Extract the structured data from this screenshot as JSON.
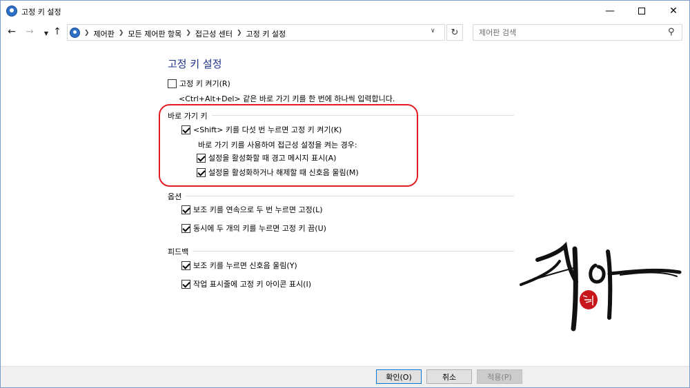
{
  "window": {
    "title": "고정 키 설정"
  },
  "nav": {
    "breadcrumbs": [
      "제어판",
      "모든 제어판 항목",
      "접근성 센터",
      "고정 키 설정"
    ],
    "search_placeholder": "제어판 검색"
  },
  "main": {
    "heading": "고정 키 설정",
    "turn_on": {
      "label": "고정 키 켜기(R)",
      "checked": false
    },
    "turn_on_desc": "<Ctrl+Alt+Del> 같은 바로 가기 키를 한 번에 하나씩 입력합니다.",
    "shortcut_section": {
      "title": "바로 가기 키",
      "shift_toggle": {
        "label": "<Shift> 키를 다섯 번 누르면 고정 키 켜기(K)",
        "checked": true
      },
      "sub_desc": "바로 가기 키를 사용하여 접근성 설정을 켜는 경우:",
      "warning": {
        "label": "설정을 활성화할 때 경고 메시지 표시(A)",
        "checked": true
      },
      "sound": {
        "label": "설정을 활성화하거나 해제할 때 신호음 울림(M)",
        "checked": true
      }
    },
    "options_section": {
      "title": "옵션",
      "lock": {
        "label": "보조 키를 연속으로 두 번 누르면 고정(L)",
        "checked": true
      },
      "turn_off": {
        "label": "동시에 두 개의 키를 누르면 고정 키 끔(U)",
        "checked": true
      }
    },
    "feedback_section": {
      "title": "피드백",
      "beep": {
        "label": "보조 키를 누르면 신호음 울림(Y)",
        "checked": true
      },
      "taskbar_icon": {
        "label": "작업 표시줄에 고정 키 아이콘 표시(I)",
        "checked": true
      }
    }
  },
  "footer": {
    "ok": "확인(O)",
    "cancel": "취소",
    "apply": "적용(P)"
  },
  "colors": {
    "heading": "#1e3287",
    "highlight": "#e31b23",
    "seal": "#c8161d"
  }
}
